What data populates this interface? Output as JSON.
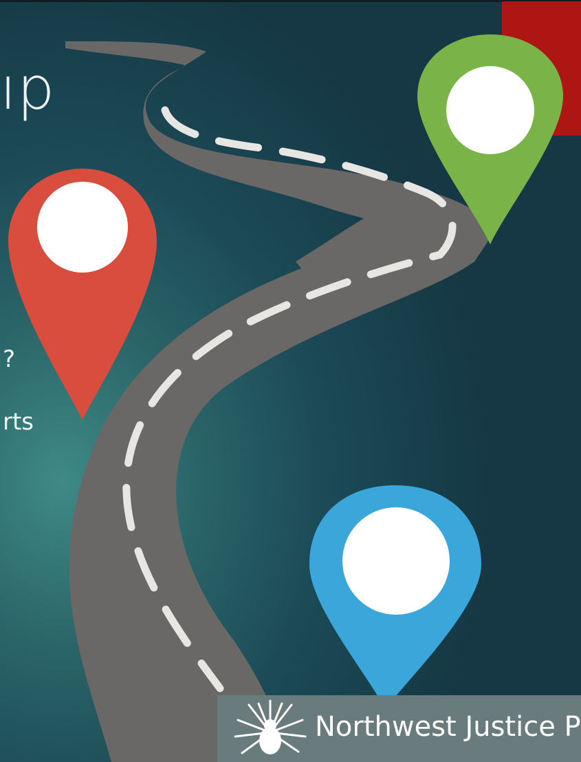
{
  "slide": {
    "title_fragment": "ıp",
    "bullets": [
      {
        "text": "?"
      },
      {
        "text": "rts"
      }
    ]
  },
  "logo": {
    "text": "Northwest Justice P"
  },
  "colors": {
    "background": "#1c4a57",
    "road": "#6a6867",
    "road_dashes": "#e8e6e3",
    "pin_red": "#d84d3e",
    "pin_green": "#7ab348",
    "pin_blue": "#3aa6d9",
    "accent_red": "#ae1614",
    "logo_box": "#6a7b7e"
  },
  "icons": {
    "logo": "sunburst-logo-icon",
    "pins": [
      "map-pin-red-icon",
      "map-pin-green-icon",
      "map-pin-blue-icon"
    ]
  }
}
